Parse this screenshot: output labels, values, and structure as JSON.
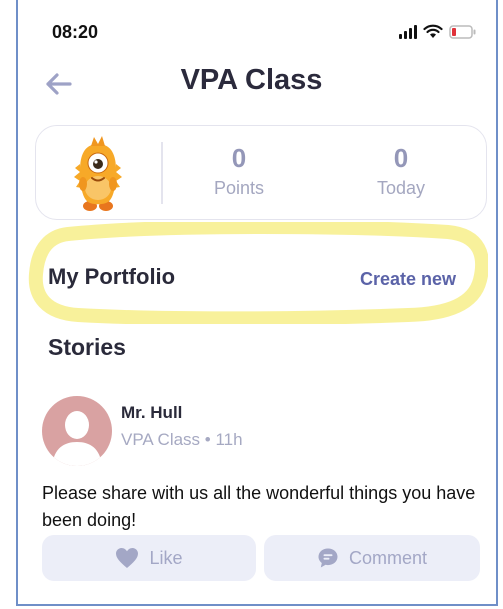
{
  "status_bar": {
    "time": "08:20"
  },
  "header": {
    "title": "VPA Class"
  },
  "stats": {
    "points": {
      "value": "0",
      "label": "Points"
    },
    "today": {
      "value": "0",
      "label": "Today"
    }
  },
  "portfolio": {
    "label": "My Portfolio",
    "create_label": "Create new"
  },
  "stories": {
    "label": "Stories",
    "post": {
      "author": "Mr. Hull",
      "meta": "VPA Class • 11h",
      "text": "Please share with us all the wonderful things you have been doing!",
      "like_label": "Like",
      "comment_label": "Comment"
    }
  },
  "colors": {
    "accent": "#5b63a8",
    "highlight": "#f7ef8a",
    "muted": "#a3a7c6",
    "button_bg": "#eceef8"
  },
  "icons": [
    "back-arrow-icon",
    "signal-icon",
    "wifi-icon",
    "battery-icon",
    "monster-avatar-icon",
    "person-avatar-icon",
    "heart-icon",
    "comment-icon"
  ]
}
